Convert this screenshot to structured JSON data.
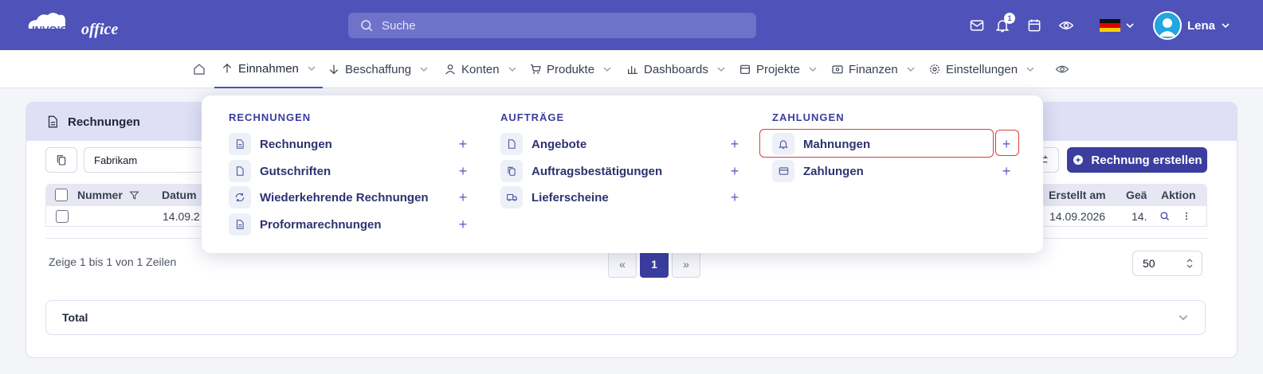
{
  "app": {
    "logo_text_bold": "INVOICE",
    "logo_text_italic": "office"
  },
  "search": {
    "placeholder": "Suche"
  },
  "header": {
    "notifications_count": "1",
    "user_name": "Lena",
    "language_flag": "de-flag-icon"
  },
  "nav": {
    "home_icon": "home-icon",
    "items": [
      {
        "label": "Einnahmen",
        "icon": "arrow-up-icon",
        "active": true
      },
      {
        "label": "Beschaffung",
        "icon": "arrow-down-icon"
      },
      {
        "label": "Konten",
        "icon": "user-icon"
      },
      {
        "label": "Produkte",
        "icon": "cart-icon"
      },
      {
        "label": "Dashboards",
        "icon": "bar-chart-icon"
      },
      {
        "label": "Projekte",
        "icon": "calendar-icon"
      },
      {
        "label": "Finanzen",
        "icon": "wallet-icon"
      },
      {
        "label": "Einstellungen",
        "icon": "gear-icon"
      }
    ],
    "extra_icon": "eye-icon"
  },
  "card": {
    "title": "Rechnungen",
    "filter_value": "Fabrikam",
    "create_button": "Rechnung erstellen",
    "columns": {
      "nummer": "Nummer",
      "datum": "Datum",
      "erstellt_am": "Erstellt am",
      "geaendert": "Geä",
      "aktion": "Aktion"
    },
    "row": {
      "datum": "14.09.2",
      "erstellt_am": "14.09.2026",
      "geaendert": "14."
    },
    "summary": "Zeige 1 bis 1 von 1 Zeilen",
    "pager": {
      "prev": "«",
      "current": "1",
      "next": "»"
    },
    "per_page": "50",
    "total_label": "Total"
  },
  "dropdown": {
    "columns": [
      {
        "heading": "RECHNUNGEN",
        "items": [
          {
            "label": "Rechnungen",
            "icon": "document-icon"
          },
          {
            "label": "Gutschriften",
            "icon": "file-icon"
          },
          {
            "label": "Wiederkehrende Rechnungen",
            "icon": "refresh-icon"
          },
          {
            "label": "Proformarechnungen",
            "icon": "document-icon"
          }
        ]
      },
      {
        "heading": "AUFTRÄGE",
        "items": [
          {
            "label": "Angebote",
            "icon": "file-icon"
          },
          {
            "label": "Auftragsbestätigungen",
            "icon": "copy-icon"
          },
          {
            "label": "Lieferscheine",
            "icon": "truck-icon"
          }
        ]
      },
      {
        "heading": "ZAHLUNGEN",
        "items": [
          {
            "label": "Mahnungen",
            "icon": "bell-icon",
            "highlighted": true
          },
          {
            "label": "Zahlungen",
            "icon": "credit-card-icon"
          }
        ]
      }
    ],
    "plus_glyph": "+"
  },
  "colors": {
    "brand": "#4f52b8",
    "primary_button": "#3b3e9e",
    "highlight": "#e23b3b"
  }
}
